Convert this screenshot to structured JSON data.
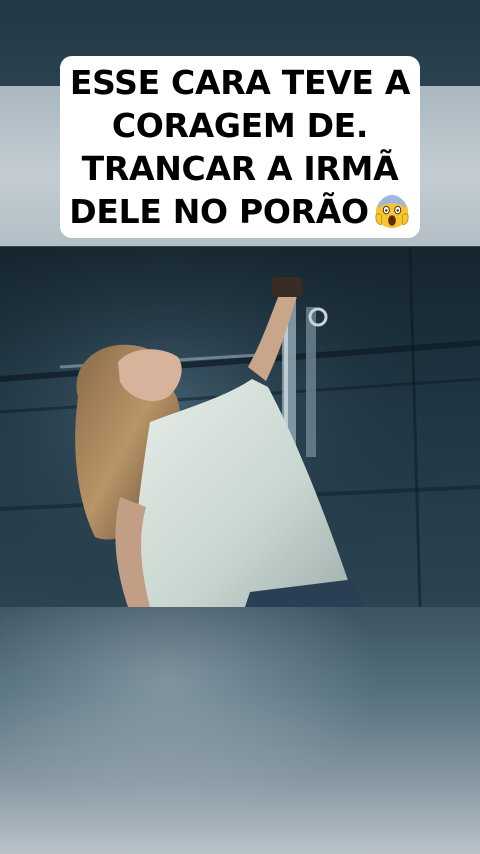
{
  "caption": {
    "lines": [
      "ESSE CARA TEVE A",
      "CORAGEM DE.",
      "TRANCAR A IRMÃ",
      "DELE NO PORÃO"
    ],
    "emoji": "screaming-face-emoji"
  },
  "video": {
    "scene": "woman-in-basement-image"
  },
  "colors": {
    "caption_bg": "#ffffff",
    "caption_text": "#000000",
    "background_tint": "#314b5a"
  }
}
